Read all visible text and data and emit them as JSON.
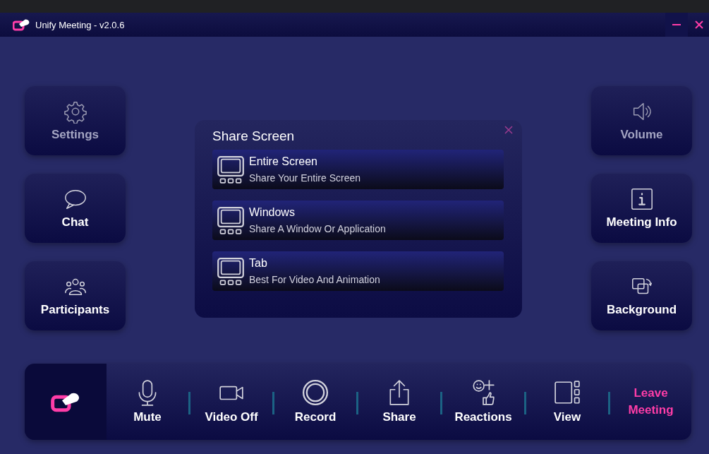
{
  "window": {
    "title": "Unify Meeting - v2.0.6"
  },
  "left_buttons": [
    {
      "label": "Settings",
      "disabled": true
    },
    {
      "label": "Chat",
      "disabled": false
    },
    {
      "label": "Participants",
      "disabled": false
    }
  ],
  "right_buttons": [
    {
      "label": "Volume",
      "disabled": true
    },
    {
      "label": "Meeting Info",
      "disabled": false
    },
    {
      "label": "Background",
      "disabled": false
    }
  ],
  "share_dialog": {
    "title": "Share Screen",
    "options": [
      {
        "title": "Entire Screen",
        "description": "Share Your Entire Screen"
      },
      {
        "title": "Windows",
        "description": "Share A Window Or Application"
      },
      {
        "title": "Tab",
        "description": "Best For Video And Animation"
      }
    ]
  },
  "toolbar": [
    {
      "label": "Mute",
      "kind": "action"
    },
    {
      "label": "Video Off",
      "kind": "action"
    },
    {
      "label": "Record",
      "kind": "action"
    },
    {
      "label": "Share",
      "kind": "action"
    },
    {
      "label": "Reactions",
      "kind": "action"
    },
    {
      "label": "View",
      "kind": "action"
    },
    {
      "label": "Leave Meeting",
      "kind": "leave"
    }
  ]
}
